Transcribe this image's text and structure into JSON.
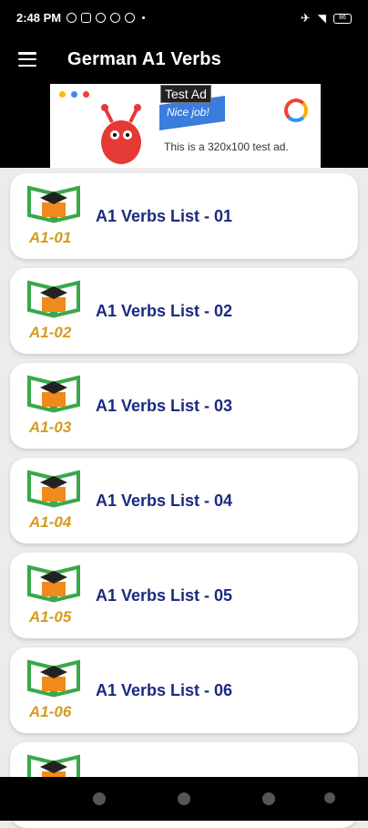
{
  "status_bar": {
    "time": "2:48 PM",
    "battery_level": "86"
  },
  "app_bar": {
    "title": "German A1 Verbs"
  },
  "ad": {
    "label": "Test Ad",
    "flag_text": "Nice job!",
    "body_text": "This is a 320x100 test ad."
  },
  "cards": [
    {
      "code": "A1-01",
      "label": "A1 Verbs List - 01"
    },
    {
      "code": "A1-02",
      "label": "A1 Verbs List - 02"
    },
    {
      "code": "A1-03",
      "label": "A1 Verbs List - 03"
    },
    {
      "code": "A1-04",
      "label": "A1 Verbs List - 04"
    },
    {
      "code": "A1-05",
      "label": "A1 Verbs List - 05"
    },
    {
      "code": "A1-06",
      "label": "A1 Verbs List - 06"
    },
    {
      "code": "",
      "label": ""
    }
  ],
  "colors": {
    "label": "#1b2a80",
    "code": "#d69a1e",
    "book_green": "#3aa84a",
    "box_orange": "#f08a1c"
  }
}
